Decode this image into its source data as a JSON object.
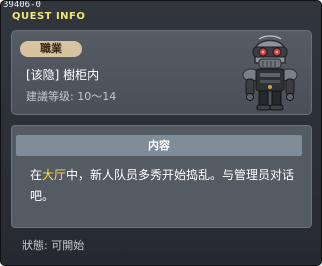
{
  "window": {
    "id_label": "39406-0",
    "title": "QUEST INFO"
  },
  "quest": {
    "job_tag": "職業",
    "name": "[该隐] 樹柜内",
    "level": "建議等级: 10～14"
  },
  "npc": {
    "icon": "robot-npc-portrait"
  },
  "content": {
    "header": "内容",
    "text_before": "在",
    "text_highlight": "大厅",
    "text_after": "中，新人队员多秀开始捣乱。与管理员对话吧。",
    "highlight_color": "#ffdf4a"
  },
  "status": {
    "text": "狀態:  可開始"
  }
}
